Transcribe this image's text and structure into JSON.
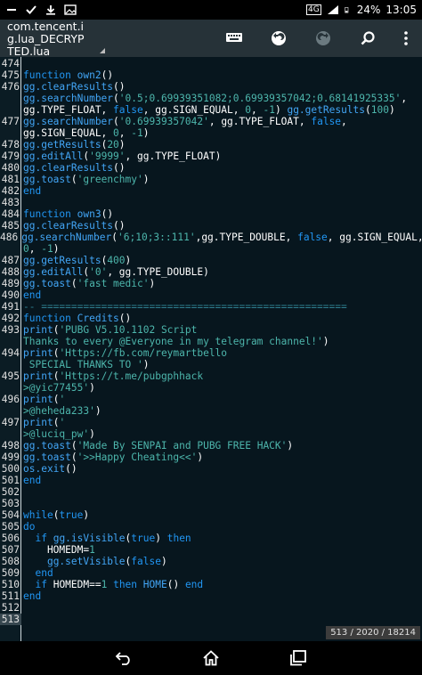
{
  "status": {
    "network": "4G",
    "battery": "24%",
    "time": "13:05"
  },
  "app": {
    "title_line1": "com.tencent.i",
    "title_line2": "g.lua_DECRYP",
    "title_line3": "TED.lua"
  },
  "toolbar": {
    "icons": [
      "keyboard-icon",
      "undo-icon",
      "redo-icon",
      "search-icon",
      "more-vert-icon"
    ]
  },
  "editor": {
    "position": "513 / 2020 / 18214"
  },
  "nav": {
    "icons": [
      "back-icon",
      "home-icon",
      "recents-icon"
    ]
  },
  "lines": [
    {
      "n": "474",
      "cont": false,
      "t": [
        {
          "c": "id",
          "s": ""
        }
      ]
    },
    {
      "n": "475",
      "cont": false,
      "t": [
        {
          "c": "kw",
          "s": "function "
        },
        {
          "c": "fn",
          "s": "own2"
        },
        {
          "c": "id",
          "s": "()"
        }
      ]
    },
    {
      "n": "476",
      "cont": false,
      "t": [
        {
          "c": "fn",
          "s": "gg.clearResults"
        },
        {
          "c": "id",
          "s": "()"
        }
      ]
    },
    {
      "n": "",
      "cont": true,
      "t": [
        {
          "c": "fn",
          "s": "gg.searchNumber"
        },
        {
          "c": "id",
          "s": "("
        },
        {
          "c": "str",
          "s": "'0.5;0.69939351082;0.69939357042;0.68141925335'"
        },
        {
          "c": "id",
          "s": ","
        }
      ]
    },
    {
      "n": "",
      "cont": true,
      "t": [
        {
          "c": "id",
          "s": "gg.TYPE_FLOAT, "
        },
        {
          "c": "kw",
          "s": "false"
        },
        {
          "c": "id",
          "s": ", gg.SIGN_EQUAL, "
        },
        {
          "c": "num",
          "s": "0"
        },
        {
          "c": "id",
          "s": ", "
        },
        {
          "c": "num",
          "s": "-1"
        },
        {
          "c": "id",
          "s": ") "
        },
        {
          "c": "fn",
          "s": "gg.getResults"
        },
        {
          "c": "id",
          "s": "("
        },
        {
          "c": "num",
          "s": "100"
        },
        {
          "c": "id",
          "s": ")"
        }
      ]
    },
    {
      "n": "477",
      "cont": false,
      "t": [
        {
          "c": "fn",
          "s": "gg.searchNumber"
        },
        {
          "c": "id",
          "s": "("
        },
        {
          "c": "str",
          "s": "'0.69939357042'"
        },
        {
          "c": "id",
          "s": ", gg.TYPE_FLOAT, "
        },
        {
          "c": "kw",
          "s": "false"
        },
        {
          "c": "id",
          "s": ","
        }
      ]
    },
    {
      "n": "",
      "cont": true,
      "t": [
        {
          "c": "id",
          "s": "gg.SIGN_EQUAL, "
        },
        {
          "c": "num",
          "s": "0"
        },
        {
          "c": "id",
          "s": ", "
        },
        {
          "c": "num",
          "s": "-1"
        },
        {
          "c": "id",
          "s": ")"
        }
      ]
    },
    {
      "n": "478",
      "cont": false,
      "t": [
        {
          "c": "fn",
          "s": "gg.getResults"
        },
        {
          "c": "id",
          "s": "("
        },
        {
          "c": "num",
          "s": "20"
        },
        {
          "c": "id",
          "s": ")"
        }
      ]
    },
    {
      "n": "479",
      "cont": false,
      "t": [
        {
          "c": "fn",
          "s": "gg.editAll"
        },
        {
          "c": "id",
          "s": "("
        },
        {
          "c": "str",
          "s": "'9999'"
        },
        {
          "c": "id",
          "s": ", gg.TYPE_FLOAT)"
        }
      ]
    },
    {
      "n": "480",
      "cont": false,
      "t": [
        {
          "c": "fn",
          "s": "gg.clearResults"
        },
        {
          "c": "id",
          "s": "()"
        }
      ]
    },
    {
      "n": "481",
      "cont": false,
      "t": [
        {
          "c": "fn",
          "s": "gg.toast"
        },
        {
          "c": "id",
          "s": "("
        },
        {
          "c": "str",
          "s": "'greenchmy'"
        },
        {
          "c": "id",
          "s": ")"
        }
      ]
    },
    {
      "n": "482",
      "cont": false,
      "t": [
        {
          "c": "kw",
          "s": "end"
        }
      ]
    },
    {
      "n": "483",
      "cont": false,
      "t": [
        {
          "c": "id",
          "s": ""
        }
      ]
    },
    {
      "n": "484",
      "cont": false,
      "t": [
        {
          "c": "kw",
          "s": "function "
        },
        {
          "c": "fn",
          "s": "own3"
        },
        {
          "c": "id",
          "s": "()"
        }
      ]
    },
    {
      "n": "485",
      "cont": false,
      "t": [
        {
          "c": "fn",
          "s": "gg.clearResults"
        },
        {
          "c": "id",
          "s": "()"
        }
      ]
    },
    {
      "n": "486",
      "cont": false,
      "t": [
        {
          "c": "fn",
          "s": "gg.searchNumber"
        },
        {
          "c": "id",
          "s": "("
        },
        {
          "c": "str",
          "s": "'6;10;3::111'"
        },
        {
          "c": "id",
          "s": ",gg.TYPE_DOUBLE, "
        },
        {
          "c": "kw",
          "s": "false"
        },
        {
          "c": "id",
          "s": ", gg.SIGN_EQUAL,"
        }
      ]
    },
    {
      "n": "",
      "cont": true,
      "t": [
        {
          "c": "num",
          "s": "0"
        },
        {
          "c": "id",
          "s": ", "
        },
        {
          "c": "num",
          "s": "-1"
        },
        {
          "c": "id",
          "s": ")"
        }
      ]
    },
    {
      "n": "487",
      "cont": false,
      "t": [
        {
          "c": "fn",
          "s": "gg.getResults"
        },
        {
          "c": "id",
          "s": "("
        },
        {
          "c": "num",
          "s": "400"
        },
        {
          "c": "id",
          "s": ")"
        }
      ]
    },
    {
      "n": "488",
      "cont": false,
      "t": [
        {
          "c": "fn",
          "s": "gg.editAll"
        },
        {
          "c": "id",
          "s": "("
        },
        {
          "c": "str",
          "s": "'0'"
        },
        {
          "c": "id",
          "s": ", gg.TYPE_DOUBLE)"
        }
      ]
    },
    {
      "n": "489",
      "cont": false,
      "t": [
        {
          "c": "fn",
          "s": "gg.toast"
        },
        {
          "c": "id",
          "s": "("
        },
        {
          "c": "str",
          "s": "'fast medic'"
        },
        {
          "c": "id",
          "s": ")"
        }
      ]
    },
    {
      "n": "490",
      "cont": false,
      "t": [
        {
          "c": "kw",
          "s": "end"
        }
      ]
    },
    {
      "n": "491",
      "cont": false,
      "t": [
        {
          "c": "com",
          "s": "-- ==================================================="
        }
      ]
    },
    {
      "n": "492",
      "cont": false,
      "t": [
        {
          "c": "kw",
          "s": "function "
        },
        {
          "c": "fn",
          "s": "Credits"
        },
        {
          "c": "id",
          "s": "()"
        }
      ]
    },
    {
      "n": "493",
      "cont": false,
      "t": [
        {
          "c": "fn",
          "s": "print"
        },
        {
          "c": "id",
          "s": "("
        },
        {
          "c": "str",
          "s": "'PUBG V5.10.1102 Script"
        }
      ]
    },
    {
      "n": "",
      "cont": true,
      "t": [
        {
          "c": "str",
          "s": "Thanks to every @Everyone in my telegram channel!'"
        },
        {
          "c": "id",
          "s": ")"
        }
      ]
    },
    {
      "n": "494",
      "cont": false,
      "t": [
        {
          "c": "fn",
          "s": "print"
        },
        {
          "c": "id",
          "s": "("
        },
        {
          "c": "str",
          "s": "'Https://fb.com/reymartbello"
        }
      ]
    },
    {
      "n": "",
      "cont": true,
      "t": [
        {
          "c": "str",
          "s": " SPECIAL THANKS TO '"
        },
        {
          "c": "id",
          "s": ")"
        }
      ]
    },
    {
      "n": "495",
      "cont": false,
      "t": [
        {
          "c": "fn",
          "s": "print"
        },
        {
          "c": "id",
          "s": "("
        },
        {
          "c": "str",
          "s": "'Https://t.me/pubgphhack"
        }
      ]
    },
    {
      "n": "",
      "cont": true,
      "t": [
        {
          "c": "str",
          "s": ">@yic77455'"
        },
        {
          "c": "id",
          "s": ")"
        }
      ]
    },
    {
      "n": "496",
      "cont": false,
      "t": [
        {
          "c": "fn",
          "s": "print"
        },
        {
          "c": "id",
          "s": "("
        },
        {
          "c": "str",
          "s": "'"
        }
      ]
    },
    {
      "n": "",
      "cont": true,
      "t": [
        {
          "c": "str",
          "s": ">@heheda233'"
        },
        {
          "c": "id",
          "s": ")"
        }
      ]
    },
    {
      "n": "497",
      "cont": false,
      "t": [
        {
          "c": "fn",
          "s": "print"
        },
        {
          "c": "id",
          "s": "("
        },
        {
          "c": "str",
          "s": "'"
        }
      ]
    },
    {
      "n": "",
      "cont": true,
      "t": [
        {
          "c": "str",
          "s": ">@luciq_pw'"
        },
        {
          "c": "id",
          "s": ")"
        }
      ]
    },
    {
      "n": "498",
      "cont": false,
      "t": [
        {
          "c": "fn",
          "s": "gg.toast"
        },
        {
          "c": "id",
          "s": "("
        },
        {
          "c": "str",
          "s": "'Made By SENPAI and PUBG FREE HACK'"
        },
        {
          "c": "id",
          "s": ")"
        }
      ]
    },
    {
      "n": "499",
      "cont": false,
      "t": [
        {
          "c": "fn",
          "s": "gg.toast"
        },
        {
          "c": "id",
          "s": "("
        },
        {
          "c": "str",
          "s": "'>>Happy Cheating<<'"
        },
        {
          "c": "id",
          "s": ")"
        }
      ]
    },
    {
      "n": "500",
      "cont": false,
      "t": [
        {
          "c": "fn",
          "s": "os.exit"
        },
        {
          "c": "id",
          "s": "()"
        }
      ]
    },
    {
      "n": "501",
      "cont": false,
      "t": [
        {
          "c": "kw",
          "s": "end"
        }
      ]
    },
    {
      "n": "502",
      "cont": false,
      "t": [
        {
          "c": "id",
          "s": ""
        }
      ]
    },
    {
      "n": "503",
      "cont": false,
      "t": [
        {
          "c": "id",
          "s": ""
        }
      ]
    },
    {
      "n": "504",
      "cont": false,
      "t": [
        {
          "c": "kw",
          "s": "while"
        },
        {
          "c": "id",
          "s": "("
        },
        {
          "c": "kw",
          "s": "true"
        },
        {
          "c": "id",
          "s": ")"
        }
      ]
    },
    {
      "n": "505",
      "cont": false,
      "t": [
        {
          "c": "kw",
          "s": "do"
        }
      ]
    },
    {
      "n": "506",
      "cont": false,
      "t": [
        {
          "c": "id",
          "s": "  "
        },
        {
          "c": "kw",
          "s": "if "
        },
        {
          "c": "fn",
          "s": "gg.isVisible"
        },
        {
          "c": "id",
          "s": "("
        },
        {
          "c": "kw",
          "s": "true"
        },
        {
          "c": "id",
          "s": ") "
        },
        {
          "c": "kw",
          "s": "then"
        }
      ]
    },
    {
      "n": "507",
      "cont": false,
      "t": [
        {
          "c": "id",
          "s": "    HOMEDM="
        },
        {
          "c": "num",
          "s": "1"
        }
      ]
    },
    {
      "n": "508",
      "cont": false,
      "t": [
        {
          "c": "id",
          "s": "    "
        },
        {
          "c": "fn",
          "s": "gg.setVisible"
        },
        {
          "c": "id",
          "s": "("
        },
        {
          "c": "kw",
          "s": "false"
        },
        {
          "c": "id",
          "s": ")"
        }
      ]
    },
    {
      "n": "509",
      "cont": false,
      "t": [
        {
          "c": "id",
          "s": "  "
        },
        {
          "c": "kw",
          "s": "end"
        }
      ]
    },
    {
      "n": "510",
      "cont": false,
      "t": [
        {
          "c": "id",
          "s": "  "
        },
        {
          "c": "kw",
          "s": "if "
        },
        {
          "c": "id",
          "s": "HOMEDM=="
        },
        {
          "c": "num",
          "s": "1"
        },
        {
          "c": "kw",
          "s": " then "
        },
        {
          "c": "fn",
          "s": "HOME"
        },
        {
          "c": "id",
          "s": "() "
        },
        {
          "c": "kw",
          "s": "end"
        }
      ]
    },
    {
      "n": "511",
      "cont": false,
      "t": [
        {
          "c": "kw",
          "s": "end"
        }
      ]
    },
    {
      "n": "512",
      "cont": false,
      "t": [
        {
          "c": "id",
          "s": ""
        }
      ]
    },
    {
      "n": "513",
      "cont": false,
      "t": [
        {
          "c": "id",
          "s": ""
        }
      ]
    }
  ]
}
